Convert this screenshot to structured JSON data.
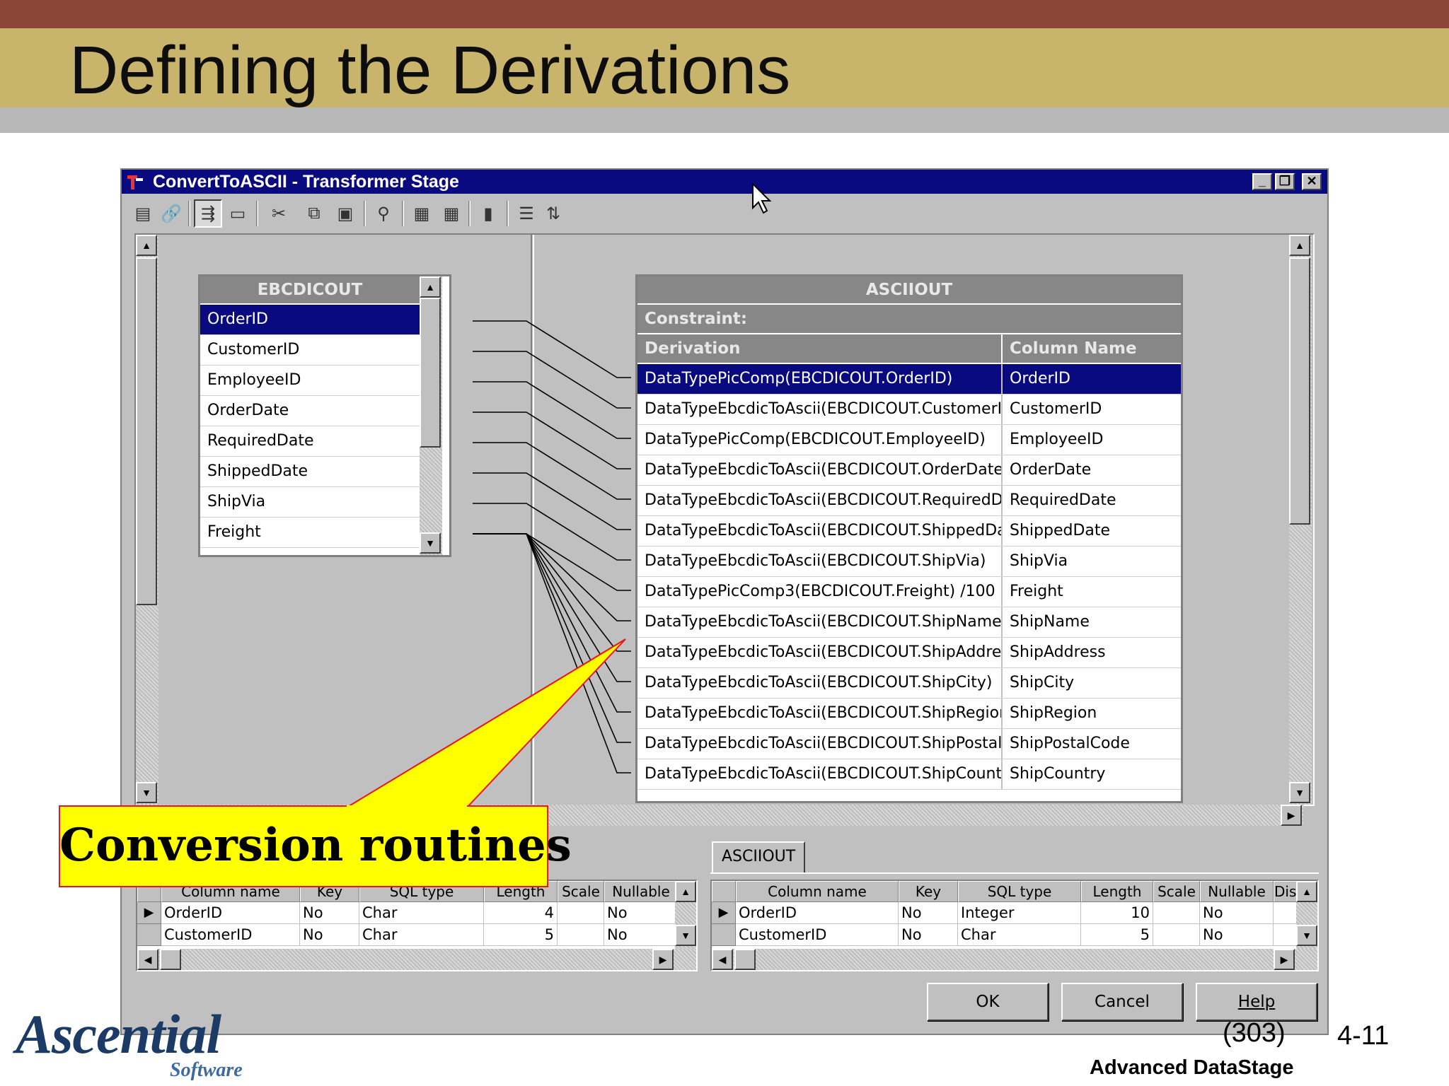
{
  "slide": {
    "title": "Defining the Derivations",
    "course": "Advanced DataStage",
    "slide_number": "4-11",
    "page_code": "(303)",
    "logo_main": "Ascential",
    "logo_sub": "Software"
  },
  "window": {
    "title": "ConvertToASCII - Transformer Stage",
    "minimize": "_",
    "restore": "❐",
    "close": "✕"
  },
  "toolbar": {
    "icons": [
      "properties-icon",
      "link-icon",
      "column-auto-match-icon",
      "input-link-order-icon",
      "cut-icon",
      "copy-icon",
      "paste-icon",
      "find-icon",
      "load-columns-icon",
      "save-columns-icon",
      "stage-variables-icon",
      "column-edit-icon",
      "reorder-icon"
    ]
  },
  "input_link": {
    "name": "EBCDICOUT",
    "columns": [
      "OrderID",
      "CustomerID",
      "EmployeeID",
      "OrderDate",
      "RequiredDate",
      "ShippedDate",
      "ShipVia",
      "Freight"
    ]
  },
  "output_link": {
    "name": "ASCIIOUT",
    "constraint_label": "Constraint:",
    "headers": {
      "derivation": "Derivation",
      "column_name": "Column Name"
    },
    "rows": [
      {
        "derivation": "DataTypePicComp(EBCDICOUT.OrderID)",
        "column": "OrderID"
      },
      {
        "derivation": "DataTypeEbcdicToAscii(EBCDICOUT.CustomerID",
        "column": "CustomerID"
      },
      {
        "derivation": "DataTypePicComp(EBCDICOUT.EmployeeID)",
        "column": "EmployeeID"
      },
      {
        "derivation": "DataTypeEbcdicToAscii(EBCDICOUT.OrderDate)",
        "column": "OrderDate"
      },
      {
        "derivation": "DataTypeEbcdicToAscii(EBCDICOUT.RequiredDa",
        "column": "RequiredDate"
      },
      {
        "derivation": "DataTypeEbcdicToAscii(EBCDICOUT.ShippedDa",
        "column": "ShippedDate"
      },
      {
        "derivation": "DataTypeEbcdicToAscii(EBCDICOUT.ShipVia)",
        "column": "ShipVia"
      },
      {
        "derivation": "DataTypePicComp3(EBCDICOUT.Freight) /100",
        "column": "Freight"
      },
      {
        "derivation": "DataTypeEbcdicToAscii(EBCDICOUT.ShipName)",
        "column": "ShipName"
      },
      {
        "derivation": "DataTypeEbcdicToAscii(EBCDICOUT.ShipAddres",
        "column": "ShipAddress"
      },
      {
        "derivation": "DataTypeEbcdicToAscii(EBCDICOUT.ShipCity)",
        "column": "ShipCity"
      },
      {
        "derivation": "DataTypeEbcdicToAscii(EBCDICOUT.ShipRegior",
        "column": "ShipRegion"
      },
      {
        "derivation": "DataTypeEbcdicToAscii(EBCDICOUT.ShipPostal(",
        "column": "ShipPostalCode"
      },
      {
        "derivation": "DataTypeEbcdicToAscii(EBCDICOUT.ShipCountr",
        "column": "ShipCountry"
      }
    ]
  },
  "left_grid": {
    "headers": [
      "Column name",
      "Key",
      "SQL type",
      "Length",
      "Scale",
      "Nullable"
    ],
    "rows": [
      [
        "OrderID",
        "No",
        "Char",
        "4",
        "",
        "No"
      ],
      [
        "CustomerID",
        "No",
        "Char",
        "5",
        "",
        "No"
      ]
    ]
  },
  "right_grid": {
    "tab": "ASCIIOUT",
    "headers": [
      "Column name",
      "Key",
      "SQL type",
      "Length",
      "Scale",
      "Nullable",
      "Disp"
    ],
    "rows": [
      [
        "OrderID",
        "No",
        "Integer",
        "10",
        "",
        "No",
        ""
      ],
      [
        "CustomerID",
        "No",
        "Char",
        "5",
        "",
        "No",
        ""
      ]
    ]
  },
  "buttons": {
    "ok": "OK",
    "cancel": "Cancel",
    "help": "Help"
  },
  "callout": {
    "text": "Conversion routines",
    "fill": "#ffff00",
    "border": "#e8141e"
  },
  "colors": {
    "title_band": "#c8b46a",
    "top_strip": "#8c4637",
    "selection": "#0a0a80"
  }
}
